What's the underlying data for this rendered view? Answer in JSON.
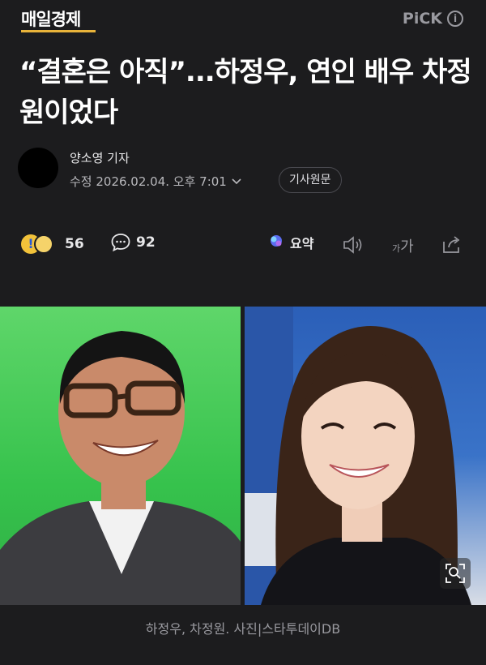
{
  "header": {
    "logo": "매일경제",
    "pick_label": "PiCK",
    "info_icon": "info-icon",
    "logo_underline_color": "#e8b33a"
  },
  "article": {
    "headline": "“결혼은 아직”...하정우, 연인 배우 차정원이었다",
    "reporter": "양소영 기자",
    "modified": "수정 2026.02.04. 오후 7:01",
    "original_button": "기사원문"
  },
  "actions": {
    "reaction_count": "56",
    "comment_count": "92",
    "summary_label": "요약",
    "font_small": "가",
    "font_large": "가"
  },
  "photo": {
    "caption": "하정우, 차정원. 사진|스타투데이DB"
  },
  "colors": {
    "background": "#1c1c1e",
    "muted_text": "#9a9aa0"
  }
}
